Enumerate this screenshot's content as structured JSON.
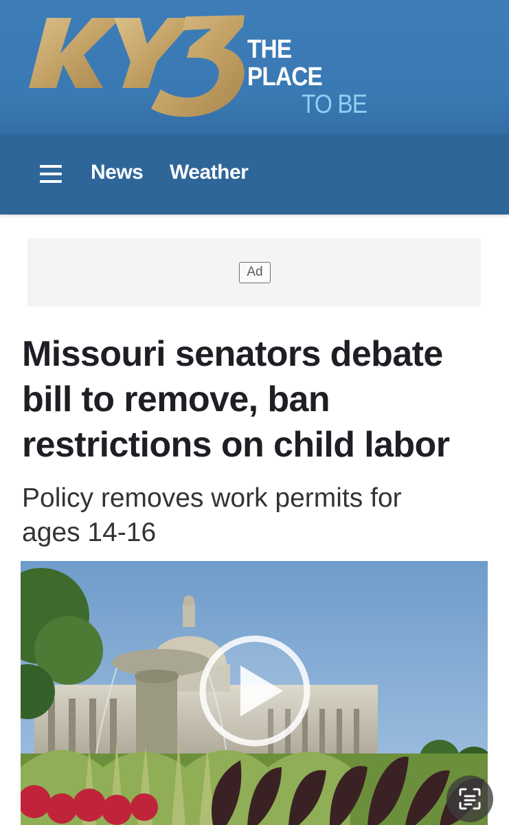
{
  "header": {
    "logo_text": "KY3",
    "tagline_line1": "THE PLACE",
    "tagline_line2": "TO BE",
    "brand_color": "#3a79b3",
    "logo_gold": "#c9a96a",
    "tagline_accent": "#8fd0f4"
  },
  "nav": {
    "menu_icon": "hamburger-menu-icon",
    "items": [
      {
        "label": "News"
      },
      {
        "label": "Weather"
      }
    ],
    "background": "#2e6699"
  },
  "ad": {
    "label": "Ad"
  },
  "article": {
    "headline_lines": [
      "Missouri senators debate",
      "bill to remove, ban",
      "restrictions on child labor"
    ],
    "subheadline_lines": [
      "Policy removes work permits for",
      "ages 14-16"
    ]
  },
  "video": {
    "play_icon": "play-icon",
    "overlay_icon": "scan-text-icon"
  }
}
